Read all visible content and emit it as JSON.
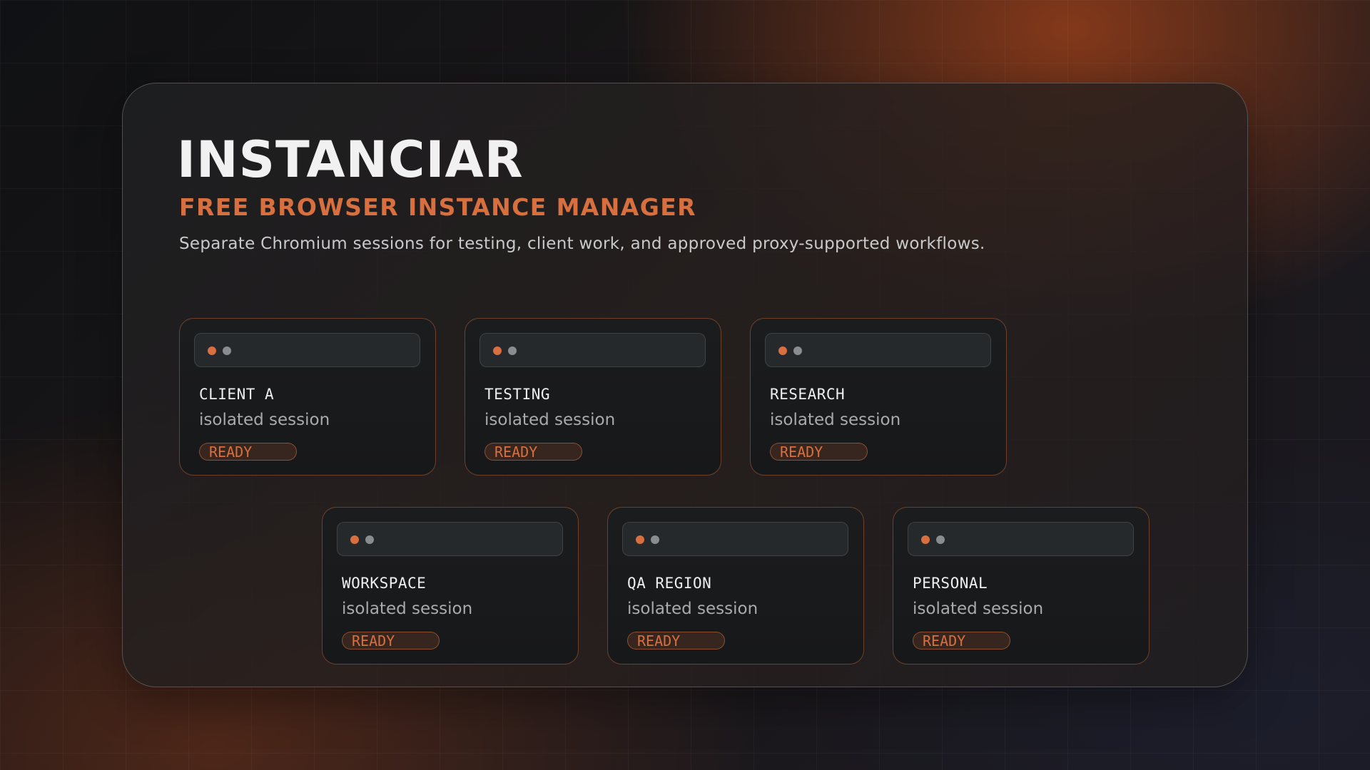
{
  "app": {
    "title": "INSTANCIAR",
    "subtitle": "FREE BROWSER INSTANCE MANAGER",
    "description": "Separate Chromium sessions for testing, client work, and approved proxy-supported workflows."
  },
  "colors": {
    "accent": "#d86f3e",
    "title": "#f1f1f1",
    "muted": "#a9aaae"
  },
  "instances": [
    {
      "name": "CLIENT A",
      "kind": "isolated session",
      "status": "READY"
    },
    {
      "name": "TESTING",
      "kind": "isolated session",
      "status": "READY"
    },
    {
      "name": "RESEARCH",
      "kind": "isolated session",
      "status": "READY"
    },
    {
      "name": "WORKSPACE",
      "kind": "isolated session",
      "status": "READY"
    },
    {
      "name": "QA REGION",
      "kind": "isolated session",
      "status": "READY"
    },
    {
      "name": "PERSONAL",
      "kind": "isolated session",
      "status": "READY"
    }
  ]
}
